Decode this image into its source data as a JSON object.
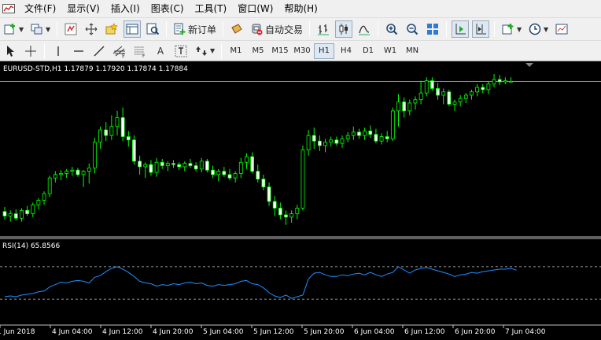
{
  "menu": {
    "items": [
      "文件(F)",
      "显示(V)",
      "插入(I)",
      "图表(C)",
      "工具(T)",
      "窗口(W)",
      "帮助(H)"
    ]
  },
  "toolbar1": {
    "new_order_label": "新订单",
    "auto_trading_label": "自动交易"
  },
  "toolbar2": {
    "text_tool": "A",
    "timeframes": [
      "M1",
      "M5",
      "M15",
      "M30",
      "H1",
      "H4",
      "D1",
      "W1",
      "MN"
    ],
    "active_timeframe": "H1"
  },
  "chart": {
    "title": "EURUSD-STD,H1  1.17879 1.17920 1.17874 1.17884",
    "indicator_label": "RSI(14) 65.8566",
    "time_labels": [
      "1 Jun 2018",
      "4 Jun 04:00",
      "4 Jun 12:00",
      "4 Jun 20:00",
      "5 Jun 04:00",
      "5 Jun 12:00",
      "5 Jun 20:00",
      "6 Jun 04:00",
      "6 Jun 12:00",
      "6 Jun 20:00",
      "7 Jun 04:00"
    ],
    "colors": {
      "background": "#000000",
      "candle": "#00ff00",
      "bull_body": "#000000",
      "bear_body": "#ffffff",
      "rsi_line": "#1e90ff",
      "price_line": "#c0c0c0",
      "level_lines": "#c0c0c0"
    }
  },
  "chart_data": {
    "type": "candlestick",
    "symbol": "EURUSD-STD",
    "timeframe": "H1",
    "last_bar": {
      "open": 1.17879,
      "high": 1.1792,
      "low": 1.17874,
      "close": 1.17884
    },
    "price_range": [
      1.165,
      1.1795
    ],
    "bars": [
      [
        1.1672,
        1.1676,
        1.1665,
        1.1668
      ],
      [
        1.1668,
        1.1673,
        1.1663,
        1.167
      ],
      [
        1.167,
        1.1674,
        1.1664,
        1.1666
      ],
      [
        1.1666,
        1.1675,
        1.1663,
        1.1673
      ],
      [
        1.1673,
        1.1677,
        1.1668,
        1.167
      ],
      [
        1.167,
        1.168,
        1.1667,
        1.1678
      ],
      [
        1.1678,
        1.1684,
        1.1674,
        1.1682
      ],
      [
        1.1682,
        1.169,
        1.1678,
        1.1688
      ],
      [
        1.1688,
        1.1704,
        1.1685,
        1.1702
      ],
      [
        1.1702,
        1.1708,
        1.1698,
        1.1705
      ],
      [
        1.1705,
        1.1709,
        1.17,
        1.1706
      ],
      [
        1.1706,
        1.171,
        1.1702,
        1.1708
      ],
      [
        1.1708,
        1.1712,
        1.1704,
        1.1709
      ],
      [
        1.1709,
        1.1711,
        1.1703,
        1.1705
      ],
      [
        1.1705,
        1.1709,
        1.1694,
        1.1708
      ],
      [
        1.1708,
        1.1715,
        1.1697,
        1.1711
      ],
      [
        1.1711,
        1.1738,
        1.1706,
        1.1734
      ],
      [
        1.1734,
        1.1748,
        1.1728,
        1.1745
      ],
      [
        1.1745,
        1.1752,
        1.1735,
        1.174
      ],
      [
        1.174,
        1.1758,
        1.1736,
        1.1748
      ],
      [
        1.1748,
        1.1762,
        1.174,
        1.1756
      ],
      [
        1.1756,
        1.1765,
        1.1735,
        1.1739
      ],
      [
        1.1739,
        1.1744,
        1.173,
        1.1736
      ],
      [
        1.1736,
        1.174,
        1.1714,
        1.1717
      ],
      [
        1.1717,
        1.1722,
        1.1705,
        1.1712
      ],
      [
        1.1712,
        1.1716,
        1.1702,
        1.1714
      ],
      [
        1.1714,
        1.1718,
        1.1704,
        1.1707
      ],
      [
        1.1707,
        1.172,
        1.1703,
        1.1716
      ],
      [
        1.1716,
        1.1719,
        1.171,
        1.1713
      ],
      [
        1.1713,
        1.1717,
        1.1708,
        1.1715
      ],
      [
        1.1715,
        1.1718,
        1.1711,
        1.1714
      ],
      [
        1.1714,
        1.1716,
        1.1709,
        1.1712
      ],
      [
        1.1712,
        1.1717,
        1.1708,
        1.1715
      ],
      [
        1.1715,
        1.1719,
        1.1711,
        1.1713
      ],
      [
        1.1713,
        1.1716,
        1.1708,
        1.171
      ],
      [
        1.171,
        1.172,
        1.1707,
        1.1717
      ],
      [
        1.1717,
        1.1719,
        1.1707,
        1.1709
      ],
      [
        1.1709,
        1.1713,
        1.1702,
        1.1705
      ],
      [
        1.1705,
        1.171,
        1.1699,
        1.1708
      ],
      [
        1.1708,
        1.1712,
        1.1703,
        1.1705
      ],
      [
        1.1705,
        1.171,
        1.17,
        1.1702
      ],
      [
        1.1702,
        1.1708,
        1.1698,
        1.1706
      ],
      [
        1.1706,
        1.172,
        1.1702,
        1.1716
      ],
      [
        1.1716,
        1.1724,
        1.171,
        1.1721
      ],
      [
        1.1721,
        1.1725,
        1.1706,
        1.1708
      ],
      [
        1.1708,
        1.1714,
        1.1698,
        1.1701
      ],
      [
        1.1701,
        1.1705,
        1.1691,
        1.1694
      ],
      [
        1.1694,
        1.1698,
        1.1677,
        1.1681
      ],
      [
        1.1681,
        1.1686,
        1.1668,
        1.1675
      ],
      [
        1.1675,
        1.168,
        1.1665,
        1.1669
      ],
      [
        1.1669,
        1.1673,
        1.166,
        1.1667
      ],
      [
        1.1667,
        1.1673,
        1.1662,
        1.167
      ],
      [
        1.167,
        1.1678,
        1.1665,
        1.1675
      ],
      [
        1.1675,
        1.1731,
        1.1673,
        1.1727
      ],
      [
        1.1727,
        1.1745,
        1.1722,
        1.174
      ],
      [
        1.174,
        1.1747,
        1.1728,
        1.1735
      ],
      [
        1.1735,
        1.174,
        1.1726,
        1.1731
      ],
      [
        1.1731,
        1.1737,
        1.1725,
        1.1734
      ],
      [
        1.1734,
        1.1739,
        1.173,
        1.1736
      ],
      [
        1.1736,
        1.1739,
        1.1731,
        1.1733
      ],
      [
        1.1733,
        1.174,
        1.1729,
        1.1737
      ],
      [
        1.1737,
        1.1743,
        1.1734,
        1.174
      ],
      [
        1.174,
        1.1748,
        1.1736,
        1.1743
      ],
      [
        1.1743,
        1.1746,
        1.1737,
        1.174
      ],
      [
        1.174,
        1.1747,
        1.1736,
        1.1744
      ],
      [
        1.1744,
        1.1749,
        1.1738,
        1.1741
      ],
      [
        1.1741,
        1.1746,
        1.1733,
        1.1735
      ],
      [
        1.1735,
        1.1742,
        1.1732,
        1.1739
      ],
      [
        1.1739,
        1.1744,
        1.1734,
        1.1737
      ],
      [
        1.1737,
        1.1765,
        1.1735,
        1.1762
      ],
      [
        1.1762,
        1.1777,
        1.1748,
        1.177
      ],
      [
        1.177,
        1.1774,
        1.1756,
        1.1762
      ],
      [
        1.1762,
        1.1772,
        1.1758,
        1.1769
      ],
      [
        1.1769,
        1.1775,
        1.1763,
        1.1772
      ],
      [
        1.1772,
        1.1789,
        1.1768,
        1.1778
      ],
      [
        1.1778,
        1.1792,
        1.1775,
        1.1789
      ],
      [
        1.1789,
        1.1792,
        1.178,
        1.1782
      ],
      [
        1.1782,
        1.1787,
        1.1772,
        1.1776
      ],
      [
        1.1776,
        1.1782,
        1.1768,
        1.1779
      ],
      [
        1.1779,
        1.1781,
        1.1766,
        1.1768
      ],
      [
        1.1768,
        1.1772,
        1.1762,
        1.177
      ],
      [
        1.177,
        1.1776,
        1.1766,
        1.1773
      ],
      [
        1.1773,
        1.1778,
        1.1769,
        1.1776
      ],
      [
        1.1776,
        1.1781,
        1.1772,
        1.1779
      ],
      [
        1.1779,
        1.1786,
        1.1775,
        1.1783
      ],
      [
        1.1783,
        1.1786,
        1.1778,
        1.1781
      ],
      [
        1.1781,
        1.1788,
        1.1777,
        1.1786
      ],
      [
        1.1786,
        1.1795,
        1.1783,
        1.179
      ],
      [
        1.179,
        1.1794,
        1.1785,
        1.1788
      ],
      [
        1.1788,
        1.1792,
        1.1786,
        1.1789
      ],
      [
        1.17879,
        1.1792,
        1.17874,
        1.17884
      ]
    ],
    "rsi": {
      "period": 14,
      "last_value": 65.8566,
      "levels": [
        70,
        30
      ],
      "values": [
        33,
        34,
        33,
        35,
        36,
        37,
        39,
        40,
        45,
        48,
        51,
        50,
        52,
        53,
        52,
        50,
        57,
        59,
        64,
        68,
        70,
        67,
        63,
        58,
        52,
        50,
        49,
        46,
        48,
        47,
        49,
        48,
        50,
        51,
        49,
        50,
        47,
        46,
        48,
        47,
        48,
        49,
        52,
        53,
        49,
        48,
        44,
        38,
        34,
        32,
        35,
        31,
        33,
        35,
        55,
        62,
        63,
        60,
        58,
        58,
        60,
        59,
        61,
        62,
        60,
        63,
        60,
        58,
        61,
        63,
        70,
        66,
        62,
        66,
        68,
        69,
        67,
        65,
        63,
        61,
        58,
        60,
        61,
        63,
        62,
        64,
        65,
        66,
        67,
        67,
        68,
        65.8566
      ]
    }
  }
}
